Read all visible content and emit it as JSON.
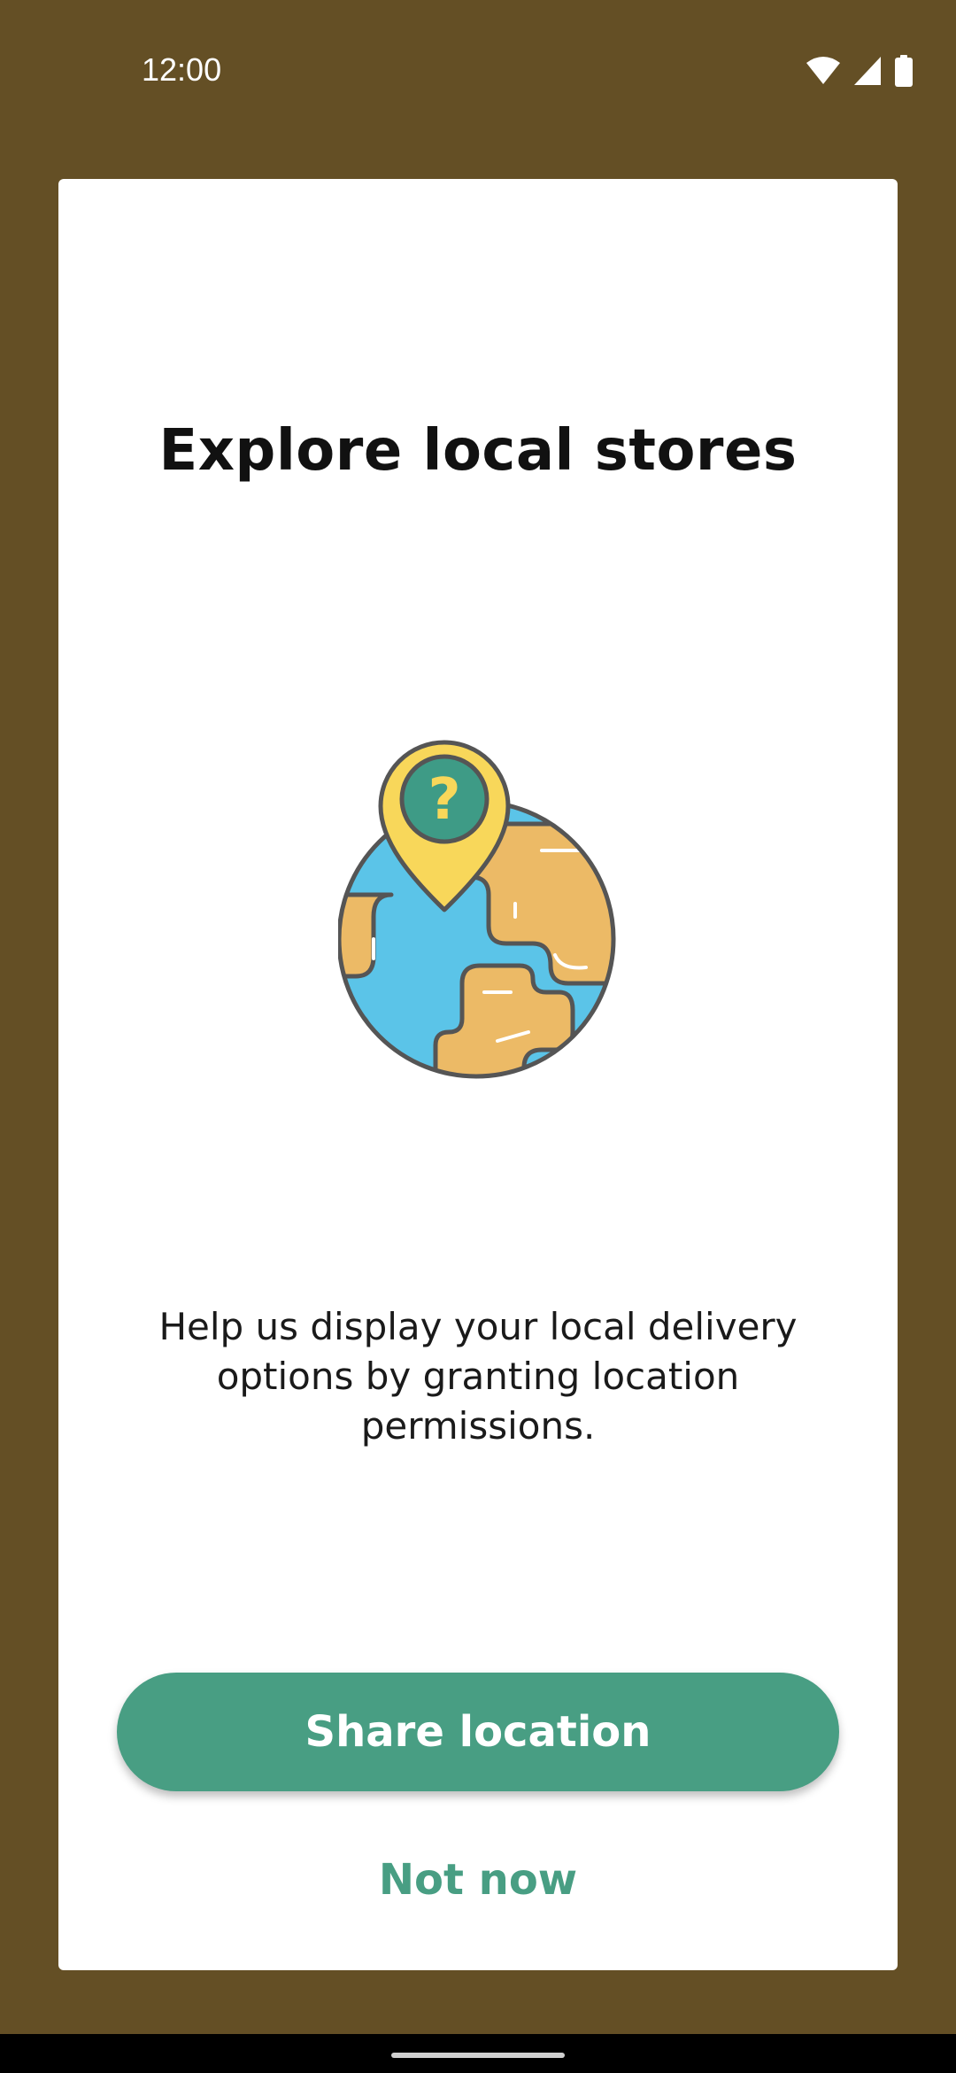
{
  "status_bar": {
    "time": "12:00",
    "icons": [
      "wifi-icon",
      "cell-signal-icon",
      "battery-icon"
    ]
  },
  "dialog": {
    "title": "Explore local stores",
    "illustration": "globe-location-question-icon",
    "description": "Help us display your local delivery options by granting location permissions.",
    "primary_label": "Share location",
    "secondary_label": "Not now"
  },
  "colors": {
    "background": "#644f25",
    "accent": "#489e83",
    "card": "#ffffff"
  }
}
